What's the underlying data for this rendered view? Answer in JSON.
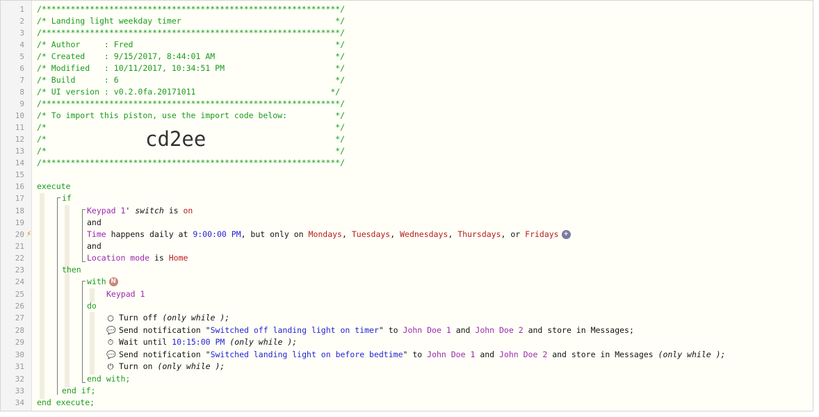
{
  "line_numbers": [
    "1",
    "2",
    "3",
    "4",
    "5",
    "6",
    "7",
    "8",
    "9",
    "10",
    "11",
    "12",
    "13",
    "14",
    "15",
    "16",
    "17",
    "18",
    "19",
    "20",
    "21",
    "22",
    "23",
    "24",
    "25",
    "26",
    "27",
    "28",
    "29",
    "30",
    "31",
    "32",
    "33",
    "34"
  ],
  "header": {
    "stars": "/**************************************************************/",
    "title": "/* Landing light weekday timer                                */",
    "author": "/* Author     : Fred                                          */",
    "created": "/* Created    : 9/15/2017, 8:44:01 AM                         */",
    "modified": "/* Modified   : 10/11/2017, 10:34:51 PM                       */",
    "build": "/* Build      : 6                                             */",
    "ui_version": "/* UI version : v0.2.0fa.20171011                            */",
    "import_line": "/* To import this piston, use the import code below:          */",
    "empty_comment": "/*                                                            */",
    "import_code": "cd2ee"
  },
  "code": {
    "execute": "execute",
    "if": "if",
    "and": "and",
    "then": "then",
    "with": "with",
    "do": "do",
    "end_with": "end with;",
    "end_if": "end if;",
    "end_execute": "end execute;",
    "cond1": {
      "device": "Keypad 1",
      "apost": "' ",
      "attr": "switch",
      "is": " is ",
      "value": "on"
    },
    "cond2": {
      "subject": "Time",
      "text1": " happens daily at ",
      "time": "9:00:00 PM",
      "text2": ", but only on ",
      "d1": "Mondays",
      "sep1": ", ",
      "d2": "Tuesdays",
      "sep2": ", ",
      "d3": "Wednesdays",
      "sep3": ", ",
      "d4": "Thursdays",
      "sep4": ", or ",
      "d5": "Fridays"
    },
    "cond3": {
      "subject": "Location mode",
      "is": " is ",
      "value": "Home"
    },
    "with_device": "Keypad 1",
    "stmt1": {
      "text": "Turn off ",
      "only": "(only while );"
    },
    "stmt2": {
      "text": "Send notification \"",
      "msg": "Switched off landing light on timer",
      "to": "\" to ",
      "u1": "John Doe 1",
      "and": " and ",
      "u2": "John Doe 2",
      "tail": " and store in Messages;"
    },
    "stmt3": {
      "text": "Wait until ",
      "time": "10:15:00 PM",
      "only": " (only while );"
    },
    "stmt4": {
      "text": "Send notification \"",
      "msg": "Switched landing light on before bedtime",
      "to": "\" to ",
      "u1": "John Doe 1",
      "and": " and ",
      "u2": "John Doe 2",
      "tail": " and store in Messages ",
      "only": "(only while );"
    },
    "stmt5": {
      "text": "Turn on ",
      "only": "(only while );"
    }
  },
  "icons": {
    "bolt": "⚡",
    "plus": "+",
    "n": "N",
    "power_off": "○",
    "chat": "💬",
    "clock": "⏱",
    "power_on": "⏻"
  }
}
